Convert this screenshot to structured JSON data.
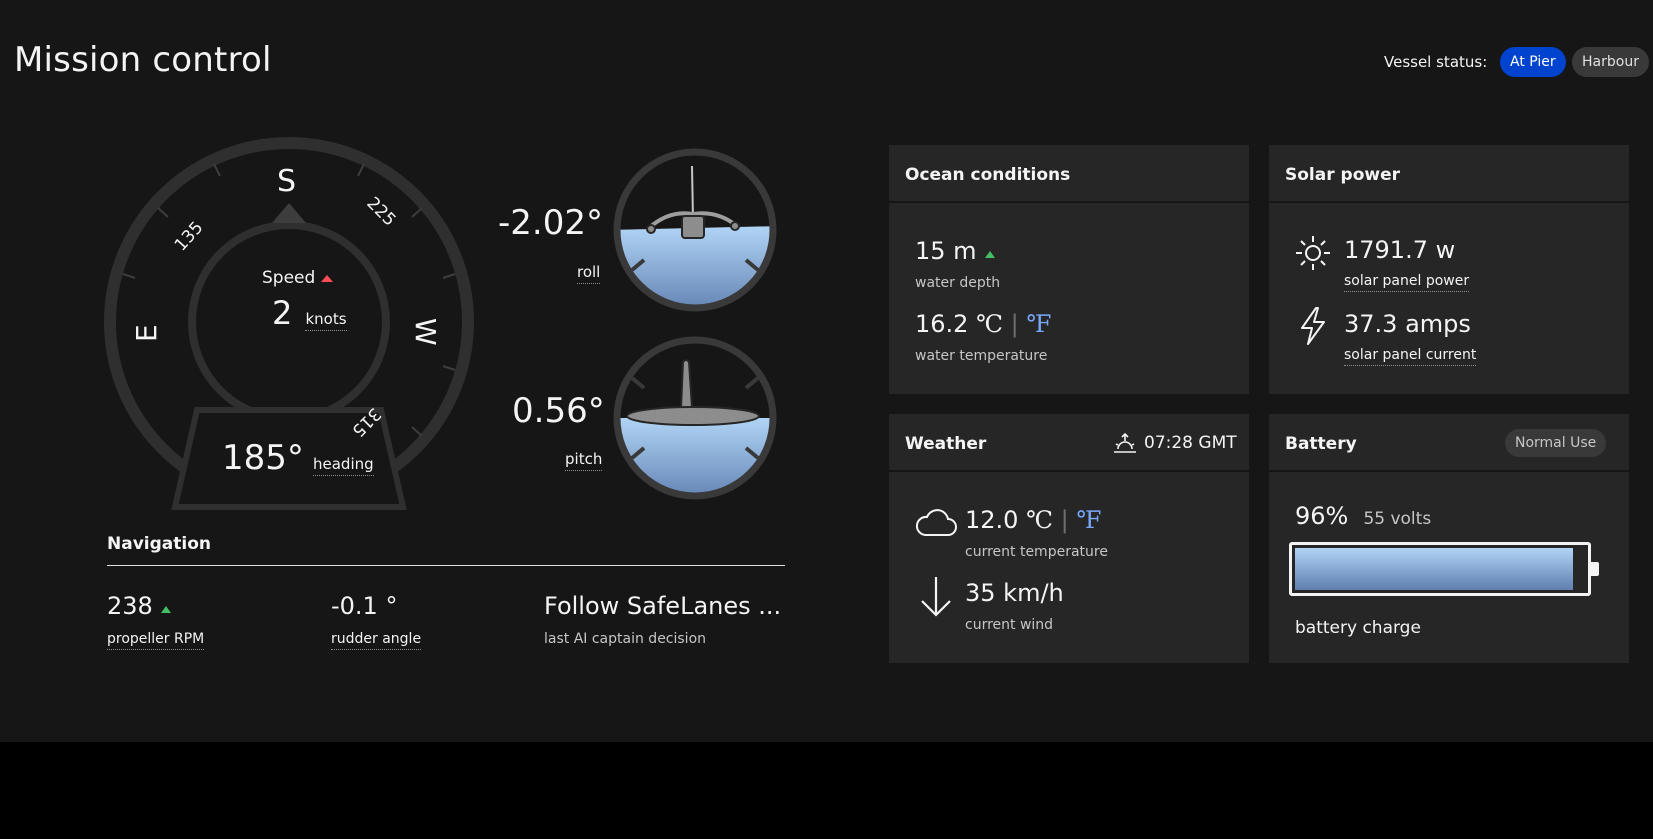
{
  "header": {
    "title": "Mission control",
    "vessel_status_label": "Vessel status:",
    "status_tags": [
      "At Pier",
      "Harbour"
    ]
  },
  "compass": {
    "labels": {
      "S": "S",
      "W": "W",
      "E": "E",
      "deg135": "135",
      "deg225": "225",
      "deg315": "315"
    },
    "speed_label": "Speed",
    "speed_value": "2",
    "speed_unit": "knots",
    "heading_value": "185°",
    "heading_label": "heading"
  },
  "attitude": {
    "roll_value": "-2.02°",
    "roll_label": "roll",
    "pitch_value": "0.56°",
    "pitch_label": "pitch"
  },
  "navigation": {
    "title": "Navigation",
    "items": [
      {
        "value": "238",
        "label": "propeller RPM"
      },
      {
        "value": "-0.1 °",
        "label": "rudder angle"
      },
      {
        "value": "Follow SafeLanes ...",
        "label": "last AI captain decision"
      }
    ]
  },
  "ocean": {
    "title": "Ocean conditions",
    "depth_value": "15 m",
    "depth_label": "water depth",
    "temp_value": "16.2",
    "temp_unit_c": "℃",
    "temp_sep": "|",
    "temp_unit_f": "℉",
    "temp_label": "water temperature"
  },
  "solar": {
    "title": "Solar power",
    "power_value": "1791.7 w",
    "power_label": "solar panel power",
    "current_value": "37.3 amps",
    "current_label": "solar panel current"
  },
  "weather": {
    "title": "Weather",
    "time": "07:28 GMT",
    "temp_value": "12.0",
    "temp_unit_c": "℃",
    "temp_sep": "|",
    "temp_unit_f": "℉",
    "temp_label": "current temperature",
    "wind_value": "35 km/h",
    "wind_label": "current wind"
  },
  "battery": {
    "title": "Battery",
    "mode": "Normal Use",
    "percent": "96%",
    "volts": "55 volts",
    "charge_fraction": 0.96,
    "label": "battery charge"
  },
  "colors": {
    "background": "#161616",
    "tile": "#262626",
    "accent_blue": "#0043ce",
    "link_blue": "#78a9ff",
    "up_green": "#42be65",
    "up_red": "#fa4d56"
  }
}
